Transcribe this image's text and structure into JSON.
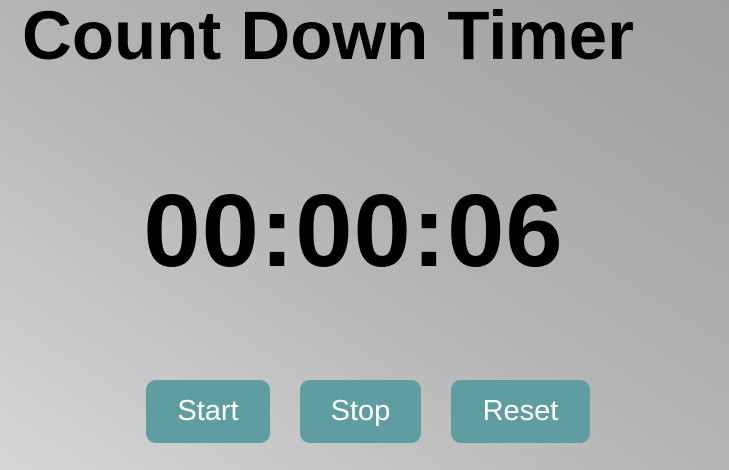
{
  "title": "Count Down Timer",
  "timer": {
    "display": "00:00:06"
  },
  "controls": {
    "start_label": "Start",
    "stop_label": "Stop",
    "reset_label": "Reset"
  },
  "colors": {
    "button_background": "#5f9ea0",
    "button_text": "#ffffff",
    "text": "#000000"
  }
}
